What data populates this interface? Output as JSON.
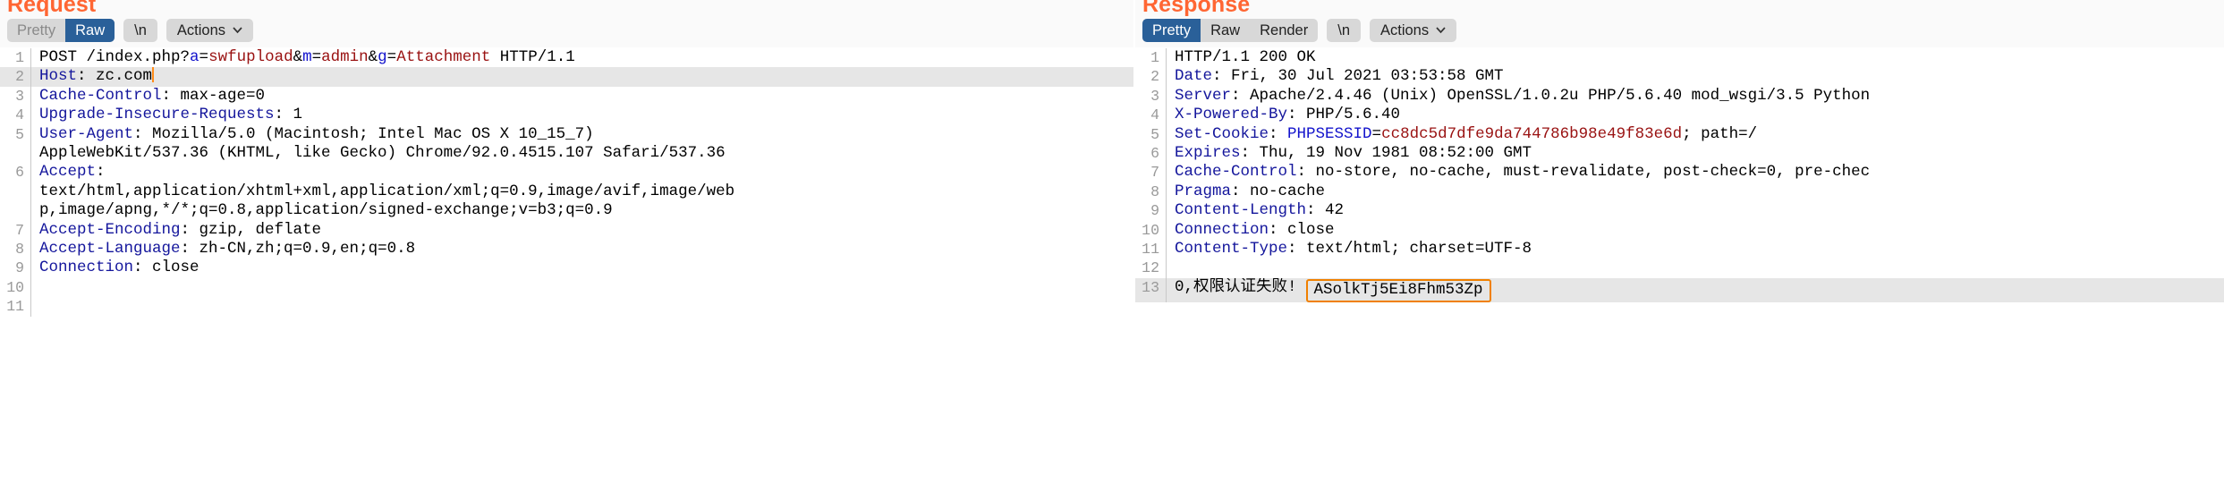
{
  "request": {
    "title": "Request",
    "tabs": [
      {
        "label": "Pretty",
        "active": false
      },
      {
        "label": "Raw",
        "active": true
      }
    ],
    "newline_pill": "\\n",
    "actions_pill": "Actions",
    "caret_icon": "chevron-down-icon",
    "lines": [
      {
        "num": "1",
        "highlight": false,
        "parts": [
          {
            "t": "POST /index.php?",
            "c": "plain"
          },
          {
            "t": "a",
            "c": "param"
          },
          {
            "t": "=",
            "c": "plain"
          },
          {
            "t": "swfupload",
            "c": "val"
          },
          {
            "t": "&",
            "c": "plain"
          },
          {
            "t": "m",
            "c": "param"
          },
          {
            "t": "=",
            "c": "plain"
          },
          {
            "t": "admin",
            "c": "val"
          },
          {
            "t": "&",
            "c": "plain"
          },
          {
            "t": "g",
            "c": "param"
          },
          {
            "t": "=",
            "c": "plain"
          },
          {
            "t": "Attachment",
            "c": "val"
          },
          {
            "t": " HTTP/1.1",
            "c": "plain"
          }
        ]
      },
      {
        "num": "2",
        "highlight": true,
        "cursor": true,
        "parts": [
          {
            "t": "Host",
            "c": "hdr"
          },
          {
            "t": ": zc.com",
            "c": "plain"
          }
        ]
      },
      {
        "num": "3",
        "highlight": false,
        "parts": [
          {
            "t": "Cache-Control",
            "c": "hdr"
          },
          {
            "t": ": max-age=0",
            "c": "plain"
          }
        ]
      },
      {
        "num": "4",
        "highlight": false,
        "parts": [
          {
            "t": "Upgrade-Insecure-Requests",
            "c": "hdr"
          },
          {
            "t": ": 1",
            "c": "plain"
          }
        ]
      },
      {
        "num": "5",
        "highlight": false,
        "parts": [
          {
            "t": "User-Agent",
            "c": "hdr"
          },
          {
            "t": ": Mozilla/5.0 (Macintosh; Intel Mac OS X 10_15_7)",
            "c": "plain"
          }
        ]
      },
      {
        "num": "",
        "highlight": false,
        "parts": [
          {
            "t": "AppleWebKit/537.36 (KHTML, like Gecko) Chrome/92.0.4515.107 Safari/537.36",
            "c": "plain"
          }
        ]
      },
      {
        "num": "6",
        "highlight": false,
        "parts": [
          {
            "t": "Accept",
            "c": "hdr"
          },
          {
            "t": ":",
            "c": "plain"
          }
        ]
      },
      {
        "num": "",
        "highlight": false,
        "parts": [
          {
            "t": "text/html,application/xhtml+xml,application/xml;q=0.9,image/avif,image/web",
            "c": "plain"
          }
        ]
      },
      {
        "num": "",
        "highlight": false,
        "parts": [
          {
            "t": "p,image/apng,*/*;q=0.8,application/signed-exchange;v=b3;q=0.9",
            "c": "plain"
          }
        ]
      },
      {
        "num": "7",
        "highlight": false,
        "parts": [
          {
            "t": "Accept-Encoding",
            "c": "hdr"
          },
          {
            "t": ": gzip, deflate",
            "c": "plain"
          }
        ]
      },
      {
        "num": "8",
        "highlight": false,
        "parts": [
          {
            "t": "Accept-Language",
            "c": "hdr"
          },
          {
            "t": ": zh-CN,zh;q=0.9,en;q=0.8",
            "c": "plain"
          }
        ]
      },
      {
        "num": "9",
        "highlight": false,
        "parts": [
          {
            "t": "Connection",
            "c": "hdr"
          },
          {
            "t": ": close",
            "c": "plain"
          }
        ]
      },
      {
        "num": "10",
        "highlight": false,
        "parts": []
      },
      {
        "num": "11",
        "highlight": false,
        "parts": []
      }
    ]
  },
  "response": {
    "title": "Response",
    "tabs": [
      {
        "label": "Pretty",
        "active": true
      },
      {
        "label": "Raw",
        "active": false
      },
      {
        "label": "Render",
        "active": false
      }
    ],
    "newline_pill": "\\n",
    "actions_pill": "Actions",
    "caret_icon": "chevron-down-icon",
    "lines": [
      {
        "num": "1",
        "highlight": false,
        "parts": [
          {
            "t": "HTTP/1.1 200 OK",
            "c": "plain"
          }
        ]
      },
      {
        "num": "2",
        "highlight": false,
        "parts": [
          {
            "t": "Date",
            "c": "hdr"
          },
          {
            "t": ": Fri, 30 Jul 2021 03:53:58 GMT",
            "c": "plain"
          }
        ]
      },
      {
        "num": "3",
        "highlight": false,
        "parts": [
          {
            "t": "Server",
            "c": "hdr"
          },
          {
            "t": ": Apache/2.4.46 (Unix) OpenSSL/1.0.2u PHP/5.6.40 mod_wsgi/3.5 Python",
            "c": "plain"
          }
        ]
      },
      {
        "num": "4",
        "highlight": false,
        "parts": [
          {
            "t": "X-Powered-By",
            "c": "hdr"
          },
          {
            "t": ": PHP/5.6.40",
            "c": "plain"
          }
        ]
      },
      {
        "num": "5",
        "highlight": false,
        "parts": [
          {
            "t": "Set-Cookie",
            "c": "hdr"
          },
          {
            "t": ": ",
            "c": "plain"
          },
          {
            "t": "PHPSESSID",
            "c": "param"
          },
          {
            "t": "=",
            "c": "plain"
          },
          {
            "t": "cc8dc5d7dfe9da744786b98e49f83e6d",
            "c": "val"
          },
          {
            "t": "; path=/",
            "c": "plain"
          }
        ]
      },
      {
        "num": "6",
        "highlight": false,
        "parts": [
          {
            "t": "Expires",
            "c": "hdr"
          },
          {
            "t": ": Thu, 19 Nov 1981 08:52:00 GMT",
            "c": "plain"
          }
        ]
      },
      {
        "num": "7",
        "highlight": false,
        "parts": [
          {
            "t": "Cache-Control",
            "c": "hdr"
          },
          {
            "t": ": no-store, no-cache, must-revalidate, post-check=0, pre-chec",
            "c": "plain"
          }
        ]
      },
      {
        "num": "8",
        "highlight": false,
        "parts": [
          {
            "t": "Pragma",
            "c": "hdr"
          },
          {
            "t": ": no-cache",
            "c": "plain"
          }
        ]
      },
      {
        "num": "9",
        "highlight": false,
        "parts": [
          {
            "t": "Content-Length",
            "c": "hdr"
          },
          {
            "t": ": 42",
            "c": "plain"
          }
        ]
      },
      {
        "num": "10",
        "highlight": false,
        "parts": [
          {
            "t": "Connection",
            "c": "hdr"
          },
          {
            "t": ": close",
            "c": "plain"
          }
        ]
      },
      {
        "num": "11",
        "highlight": false,
        "parts": [
          {
            "t": "Content-Type",
            "c": "hdr"
          },
          {
            "t": ": text/html; charset=UTF-8",
            "c": "plain"
          }
        ]
      },
      {
        "num": "12",
        "highlight": false,
        "parts": []
      },
      {
        "num": "13",
        "highlight": true,
        "parts": [
          {
            "t": "0,权限认证失败!",
            "c": "plain"
          }
        ],
        "boxed": "ASolkTj5Ei8Fhm53Zp"
      }
    ]
  },
  "colors": {
    "accent_title": "#ff6633",
    "tab_active_bg": "#2a6099",
    "header_name": "#14169c",
    "param_name": "#1414cc",
    "param_value": "#991111",
    "highlight_row": "#e6e6e6",
    "box_border": "#f08000"
  }
}
